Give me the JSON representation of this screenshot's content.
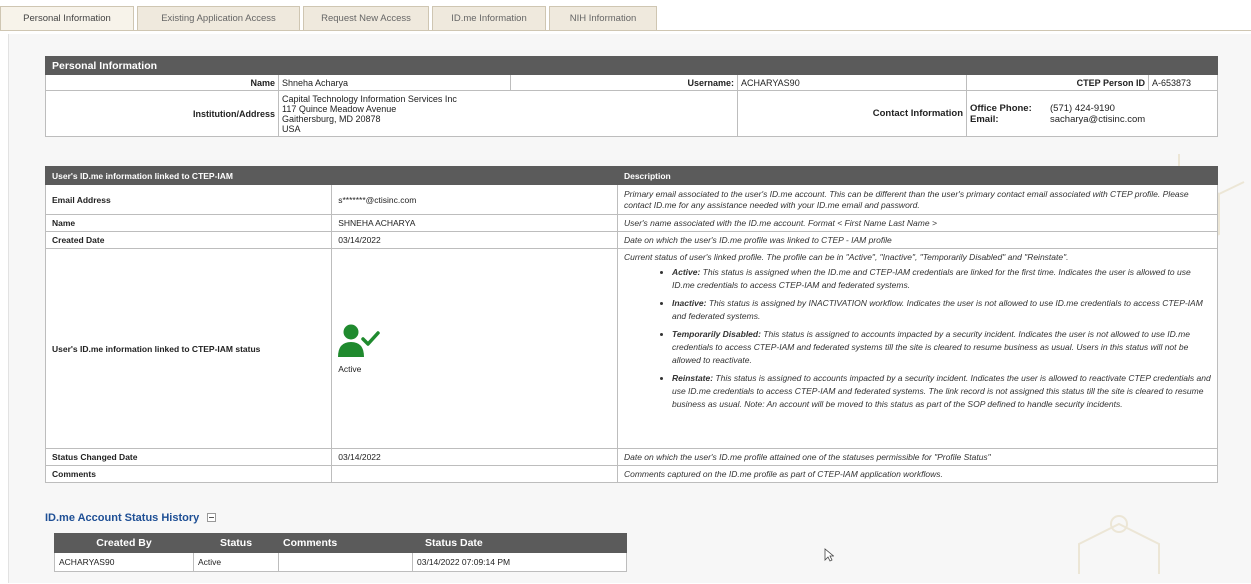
{
  "tabs": [
    {
      "label": "Personal Information"
    },
    {
      "label": "Existing Application Access"
    },
    {
      "label": "Request New Access"
    },
    {
      "label": "ID.me Information"
    },
    {
      "label": "NIH Information"
    }
  ],
  "personal": {
    "title": "Personal Information",
    "name_label": "Name",
    "name_value": "Shneha Acharya",
    "username_label": "Username:",
    "username_value": "ACHARYAS90",
    "cteppid_label": "CTEP Person ID",
    "cteppid_value": "A-653873",
    "inst_label": "Institution/Address",
    "inst_lines": [
      "Capital Technology Information Services Inc",
      "117 Quince Meadow Avenue",
      "Gaithersburg, MD  20878",
      "USA"
    ],
    "contact_label": "Contact Information",
    "office_label": "Office Phone:",
    "office_value": "(571) 424-9190",
    "email_label": "Email:",
    "email_value": "sacharya@ctisinc.com"
  },
  "idme": {
    "title": "User's ID.me information linked to CTEP-IAM",
    "desc_header": "Description",
    "rows": [
      {
        "label": "Email Address",
        "value": "s*******@ctisinc.com",
        "desc": "Primary email associated to the user's ID.me account. This can be different than the user's primary contact email associated with CTEP profile. Please contact ID.me for any assistance needed with your ID.me email and password."
      },
      {
        "label": "Name",
        "value": "SHNEHA ACHARYA",
        "desc": "User's name associated with the ID.me account. Format < First Name Last Name >"
      },
      {
        "label": "Created Date",
        "value": "03/14/2022",
        "desc": "Date on which the user's ID.me profile was linked to CTEP - IAM profile"
      }
    ],
    "status_label": "User's ID.me information linked to CTEP-IAM status",
    "status_value": "Active",
    "status_intro": "Current status of user's linked profile. The profile can be in \"Active\", \"Inactive\", \"Temporarily Disabled\" and \"Reinstate\".",
    "status_items": [
      {
        "name": "Active:",
        "text": " This status is assigned when the ID.me and CTEP-IAM credentials are linked for the first time. Indicates the user is allowed to use ID.me credentials to access CTEP-IAM and federated systems."
      },
      {
        "name": "Inactive:",
        "text": " This status is assigned by INACTIVATION workflow. Indicates the user is not allowed to use ID.me credentials to access CTEP-IAM and federated systems."
      },
      {
        "name": "Temporarily Disabled:",
        "text": " This status is assigned to accounts impacted by a security incident. Indicates the user is not allowed to use ID.me credentials to access CTEP-IAM and federated systems till the site is cleared to resume business as usual. Users in this status will not be allowed to reactivate."
      },
      {
        "name": "Reinstate:",
        "text": " This status is assigned to accounts impacted by a security incident. Indicates the user is allowed to reactivate CTEP credentials and use ID.me credentials to access CTEP-IAM and federated systems. The link record is not assigned this status till the site is cleared to resume business as usual. Note: An account will be moved to this status as part of the SOP defined to handle security incidents."
      }
    ],
    "changed_label": "Status Changed Date",
    "changed_value": "03/14/2022",
    "changed_desc": "Date on which the user's ID.me profile attained one of the statuses permissible for \"Profile Status\"",
    "comments_label": "Comments",
    "comments_value": "",
    "comments_desc": "Comments captured on the ID.me profile as part of CTEP-IAM application workflows."
  },
  "history": {
    "title": "ID.me Account Status History",
    "headers": [
      "Created By",
      "Status",
      "Comments",
      "Status Date"
    ],
    "rows": [
      [
        "ACHARYAS90",
        "Active",
        "",
        "03/14/2022 07:09:14 PM"
      ]
    ]
  },
  "colors": {
    "header": "#5b5b5b",
    "link": "#1e4f95",
    "status_icon": "#1f8a2e"
  }
}
